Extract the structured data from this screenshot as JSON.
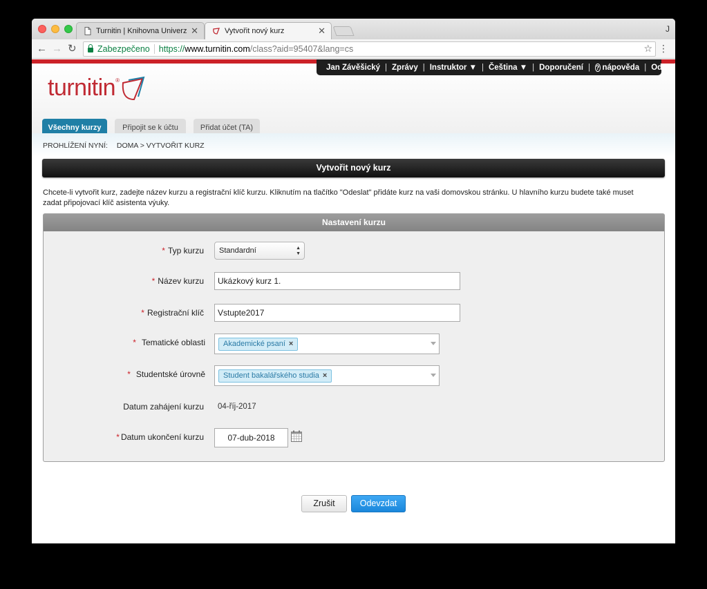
{
  "browser": {
    "tabs": [
      {
        "title": "Turnitin | Knihovna Univerzity K",
        "active": false
      },
      {
        "title": "Vytvořit nový kurz",
        "active": true
      }
    ],
    "profile_initial": "J",
    "secure_label": "Zabezpečeno",
    "url_scheme": "https://",
    "url_host": "www.turnitin.com",
    "url_path": "/class?aid=95407&lang=cs"
  },
  "usernav": {
    "user": "Jan Závěšický",
    "messages": "Zprávy",
    "role": "Instruktor ▼",
    "language": "Čeština ▼",
    "recommendations": "Doporučení",
    "help": "nápověda",
    "logout": "Odhlášení"
  },
  "logo": {
    "text": "turnitin",
    "mark": "®"
  },
  "nav_tabs": [
    "Všechny kurzy",
    "Připojit se k účtu",
    "Přidat účet (TA)"
  ],
  "breadcrumb": {
    "prefix": "PROHLÍŽENÍ NYNÍ:",
    "home": "DOMA",
    "current": "> VYTVOŘIT KURZ"
  },
  "page_title": "Vytvořit nový kurz",
  "intro": "Chcete-li vytvořit kurz, zadejte název kurzu a registrační klíč kurzu. Kliknutím na tlačítko \"Odeslat\" přidáte kurz na vaši domovskou stránku. U hlavního kurzu budete také muset zadat připojovací klíč asistenta výuky.",
  "settings": {
    "header": "Nastavení kurzu",
    "required_mark": "*",
    "course_type": {
      "label": "Typ kurzu",
      "value": "Standardní"
    },
    "course_name": {
      "label": "Název kurzu",
      "value": "Ukázkový kurz 1."
    },
    "enroll_key": {
      "label": "Registrační klíč",
      "value": "Vstupte2017"
    },
    "subject_areas": {
      "label": "Tematické oblasti",
      "chip": "Akademické psaní",
      "remove": "×"
    },
    "student_levels": {
      "label": "Studentské úrovně",
      "chip": "Student bakalářského studia",
      "remove": "×"
    },
    "start_date": {
      "label": "Datum zahájení kurzu",
      "value": "04-říj-2017"
    },
    "end_date": {
      "label": "Datum ukončení kurzu",
      "value": "07-dub-2018"
    }
  },
  "buttons": {
    "cancel": "Zrušit",
    "submit": "Odevzdat"
  },
  "colors": {
    "brand_red": "#cc2229",
    "tab_blue": "#1f7fa6",
    "submit_blue": "#1a87db"
  }
}
